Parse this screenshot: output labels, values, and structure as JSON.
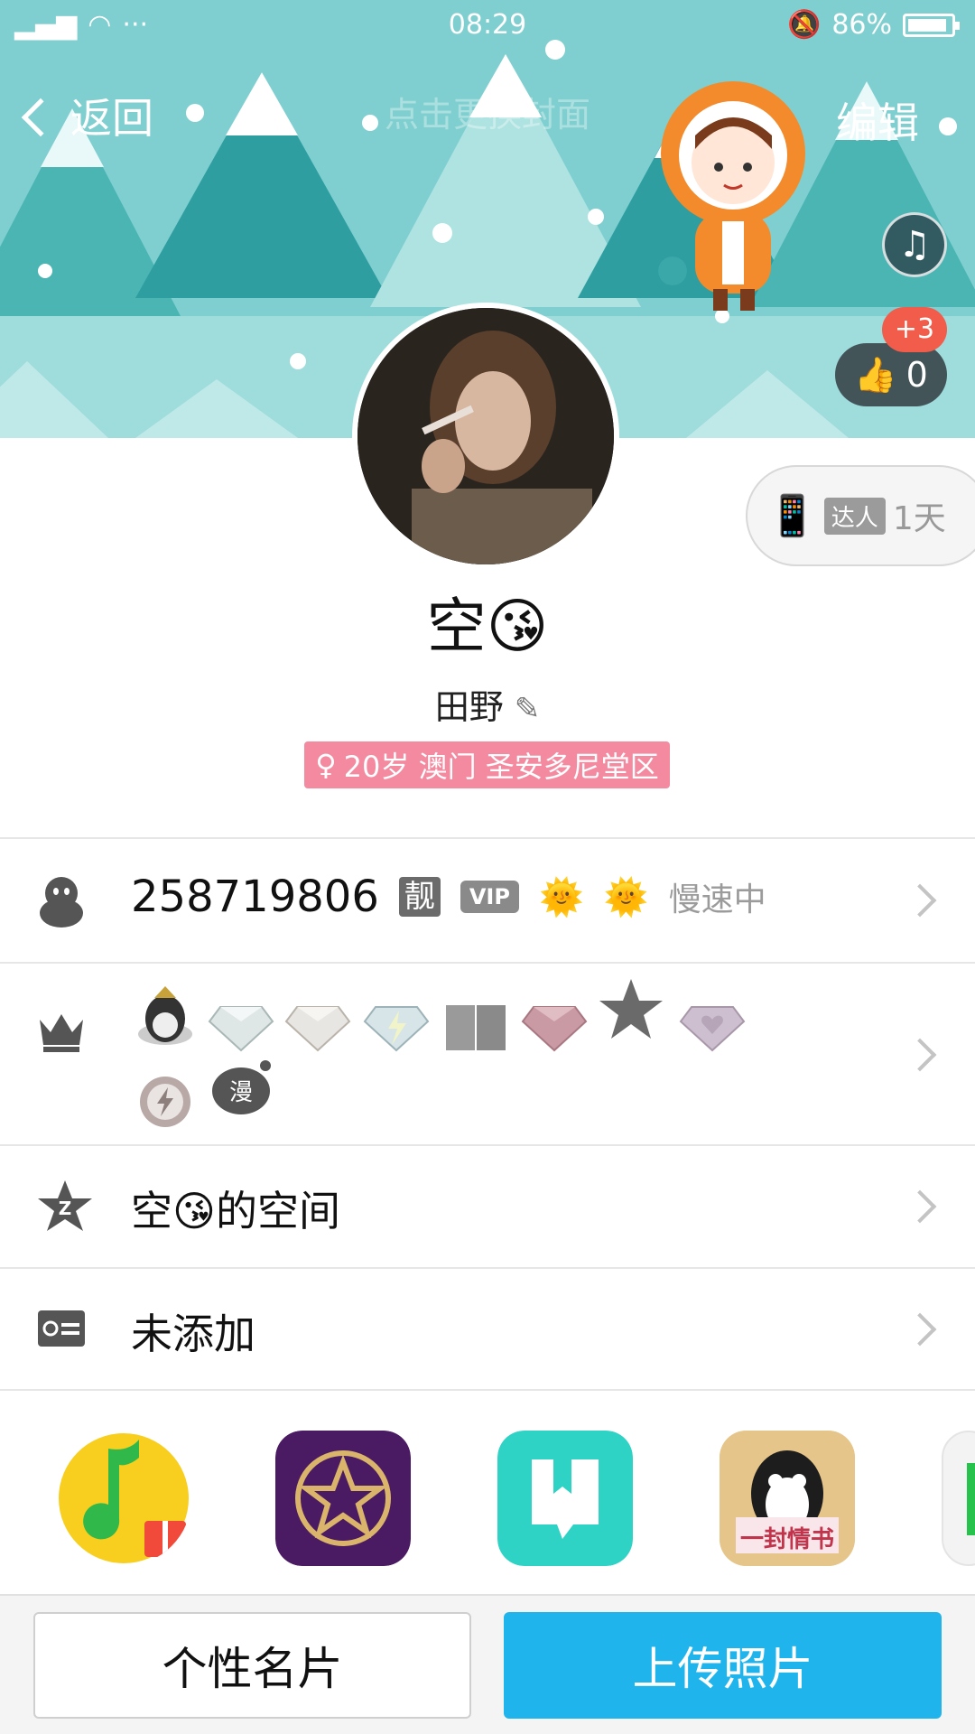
{
  "status_bar": {
    "time": "08:29",
    "battery": "86%"
  },
  "header": {
    "back_label": "返回",
    "cover_hint": "点击更换封面",
    "edit_label": "编辑"
  },
  "like": {
    "badge": "+3",
    "count": "0"
  },
  "talent": {
    "tag": "达人",
    "days": "1天"
  },
  "profile": {
    "nickname": "空😘",
    "remark": "田野",
    "info": "20岁 澳门 圣安多尼堂区"
  },
  "qq_row": {
    "number": "258719806",
    "pretty_tag": "靓",
    "vip_tag": "VIP",
    "speed": "慢速中"
  },
  "badge_row": {},
  "space_row": {
    "label": "空😘的空间"
  },
  "card_row": {
    "label": "未添加"
  },
  "apps": [
    "qq-music-app",
    "star-app",
    "reader-app",
    "love-letter-app"
  ],
  "app_labels": {
    "love_letter": "一封情书"
  },
  "bottom": {
    "card_button": "个性名片",
    "upload_button": "上传照片"
  },
  "colors": {
    "accent": "#1fb5ec",
    "cover": "#7fcfcf",
    "badge_pink": "#f48aa0",
    "like_red": "#f25c4a"
  }
}
